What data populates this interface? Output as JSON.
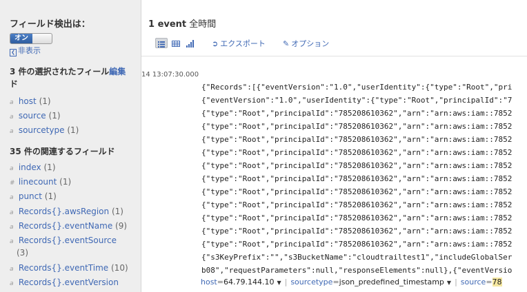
{
  "sidebar": {
    "title": "フィールド検出は：",
    "toggle_on": "オン",
    "hide_label": "非表示",
    "selected_heading": "3 件の選択されたフィール",
    "selected_heading_tail": "ド",
    "edit_label": "編集",
    "selected_fields": [
      {
        "type": "a",
        "name": "host",
        "count": "(1)"
      },
      {
        "type": "a",
        "name": "source",
        "count": "(1)"
      },
      {
        "type": "a",
        "name": "sourcetype",
        "count": "(1)"
      }
    ],
    "related_heading": "35 件の関連するフィールド",
    "related_fields": [
      {
        "type": "a",
        "name": "index",
        "count": "(1)"
      },
      {
        "type": "#",
        "name": "linecount",
        "count": "(1)"
      },
      {
        "type": "a",
        "name": "punct",
        "count": "(1)"
      },
      {
        "type": "a",
        "name": "Records{}.awsRegion",
        "count": "(1)"
      },
      {
        "type": "a",
        "name": "Records{}.eventName",
        "count": "(9)"
      },
      {
        "type": "a",
        "name": "Records{}.eventSource",
        "count": "(3)"
      },
      {
        "type": "a",
        "name": "Records{}.eventTime",
        "count": "(10)"
      },
      {
        "type": "a",
        "name": "Records{}.eventVersion",
        "count": ""
      }
    ]
  },
  "main": {
    "event_count": "1 event",
    "time_range": "全時間",
    "toolbar": {
      "export_label": "エクスポート",
      "options_label": "オプション",
      "view_icons": [
        "list-view-icon",
        "table-view-icon",
        "chart-view-icon"
      ]
    },
    "event": {
      "timestamp": "14 13:07:30.000",
      "lines": [
        "{\"Records\":[{\"eventVersion\":\"1.0\",\"userIdentity\":{\"type\":\"Root\",\"pri",
        "{\"eventVersion\":\"1.0\",\"userIdentity\":{\"type\":\"Root\",\"principalId\":\"7",
        "{\"type\":\"Root\",\"principalId\":\"785208610362\",\"arn\":\"arn:aws:iam::7852",
        "{\"type\":\"Root\",\"principalId\":\"785208610362\",\"arn\":\"arn:aws:iam::7852",
        "{\"type\":\"Root\",\"principalId\":\"785208610362\",\"arn\":\"arn:aws:iam::7852",
        "{\"type\":\"Root\",\"principalId\":\"785208610362\",\"arn\":\"arn:aws:iam::7852",
        "{\"type\":\"Root\",\"principalId\":\"785208610362\",\"arn\":\"arn:aws:iam::7852",
        "{\"type\":\"Root\",\"principalId\":\"785208610362\",\"arn\":\"arn:aws:iam::7852",
        "{\"type\":\"Root\",\"principalId\":\"785208610362\",\"arn\":\"arn:aws:iam::7852",
        "{\"type\":\"Root\",\"principalId\":\"785208610362\",\"arn\":\"arn:aws:iam::7852",
        "{\"type\":\"Root\",\"principalId\":\"785208610362\",\"arn\":\"arn:aws:iam::7852",
        "{\"type\":\"Root\",\"principalId\":\"785208610362\",\"arn\":\"arn:aws:iam::7852",
        "{\"type\":\"Root\",\"principalId\":\"785208610362\",\"arn\":\"arn:aws:iam::7852",
        "{\"s3KeyPrefix\":\"\",\"s3BucketName\":\"cloudtrailtest1\",\"includeGlobalSer",
        "b08\",\"requestParameters\":null,\"responseElements\":null},{\"eventVersio"
      ],
      "meta": [
        {
          "key": "host",
          "value": "64.79.144.10"
        },
        {
          "key": "sourcetype",
          "value": "json_predefined_timestamp"
        },
        {
          "key": "source",
          "value": "78"
        }
      ]
    }
  },
  "colors": {
    "link": "#3f68b4",
    "sidebar_bg": "#eeeeee",
    "toggle_on": "#2e5c9e",
    "highlight": "#f5e7a0"
  }
}
